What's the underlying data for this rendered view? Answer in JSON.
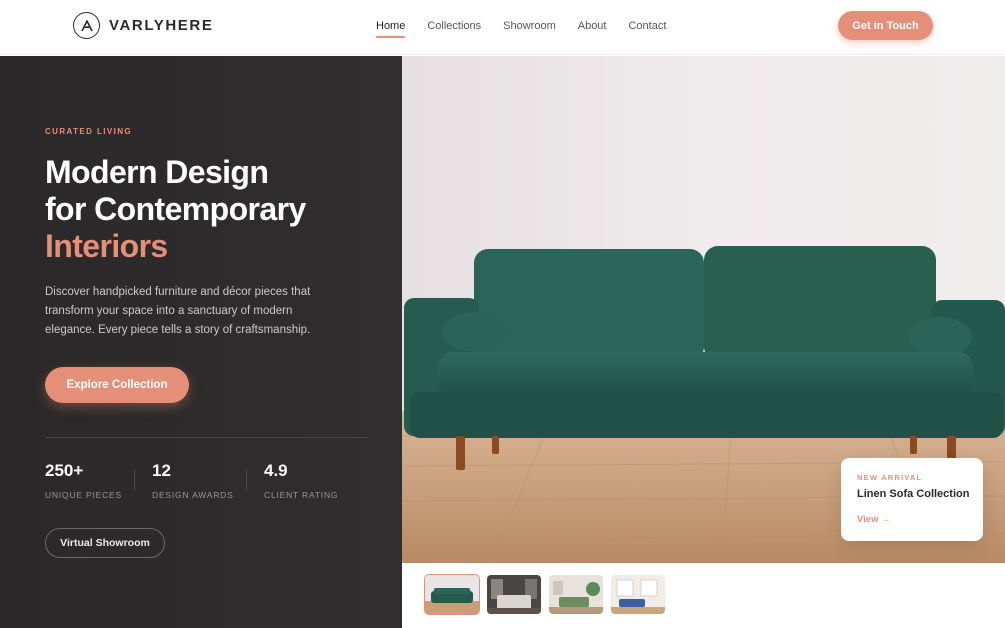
{
  "brand": {
    "name": "VARLYHERE",
    "logo_icon": "a-monogram-icon"
  },
  "nav": {
    "items": [
      {
        "label": "Home",
        "active": true
      },
      {
        "label": "Collections",
        "active": false
      },
      {
        "label": "Showroom",
        "active": false
      },
      {
        "label": "About",
        "active": false
      },
      {
        "label": "Contact",
        "active": false
      }
    ],
    "cta_label": "Get in Touch"
  },
  "hero": {
    "eyebrow": "CURATED LIVING",
    "title_line1": "Modern Design",
    "title_line2": "for Contemporary",
    "title_accent": "Interiors",
    "description": "Discover handpicked furniture and décor pieces that transform your space into a sanctuary of modern elegance. Every piece tells a story of craftsmanship.",
    "primary_button": "Explore Collection",
    "secondary_button": "Virtual Showroom",
    "stats": [
      {
        "value": "250+",
        "label": "UNIQUE PIECES"
      },
      {
        "value": "12",
        "label": "DESIGN AWARDS"
      },
      {
        "value": "4.9",
        "label": "CLIENT RATING"
      }
    ]
  },
  "feature_card": {
    "eyebrow": "NEW ARRIVAL",
    "title": "Linen Sofa Collection",
    "link": "View →"
  },
  "thumbnails": [
    {
      "name": "green-sofa-thumbnail",
      "active": true
    },
    {
      "name": "bedroom-thumbnail",
      "active": false
    },
    {
      "name": "living-room-thumbnail",
      "active": false
    },
    {
      "name": "bright-room-thumbnail",
      "active": false
    }
  ],
  "colors": {
    "accent": "#e58f78",
    "dark_panel": "#2b2929",
    "sofa": "#23574b",
    "floor": "#c89d78"
  }
}
